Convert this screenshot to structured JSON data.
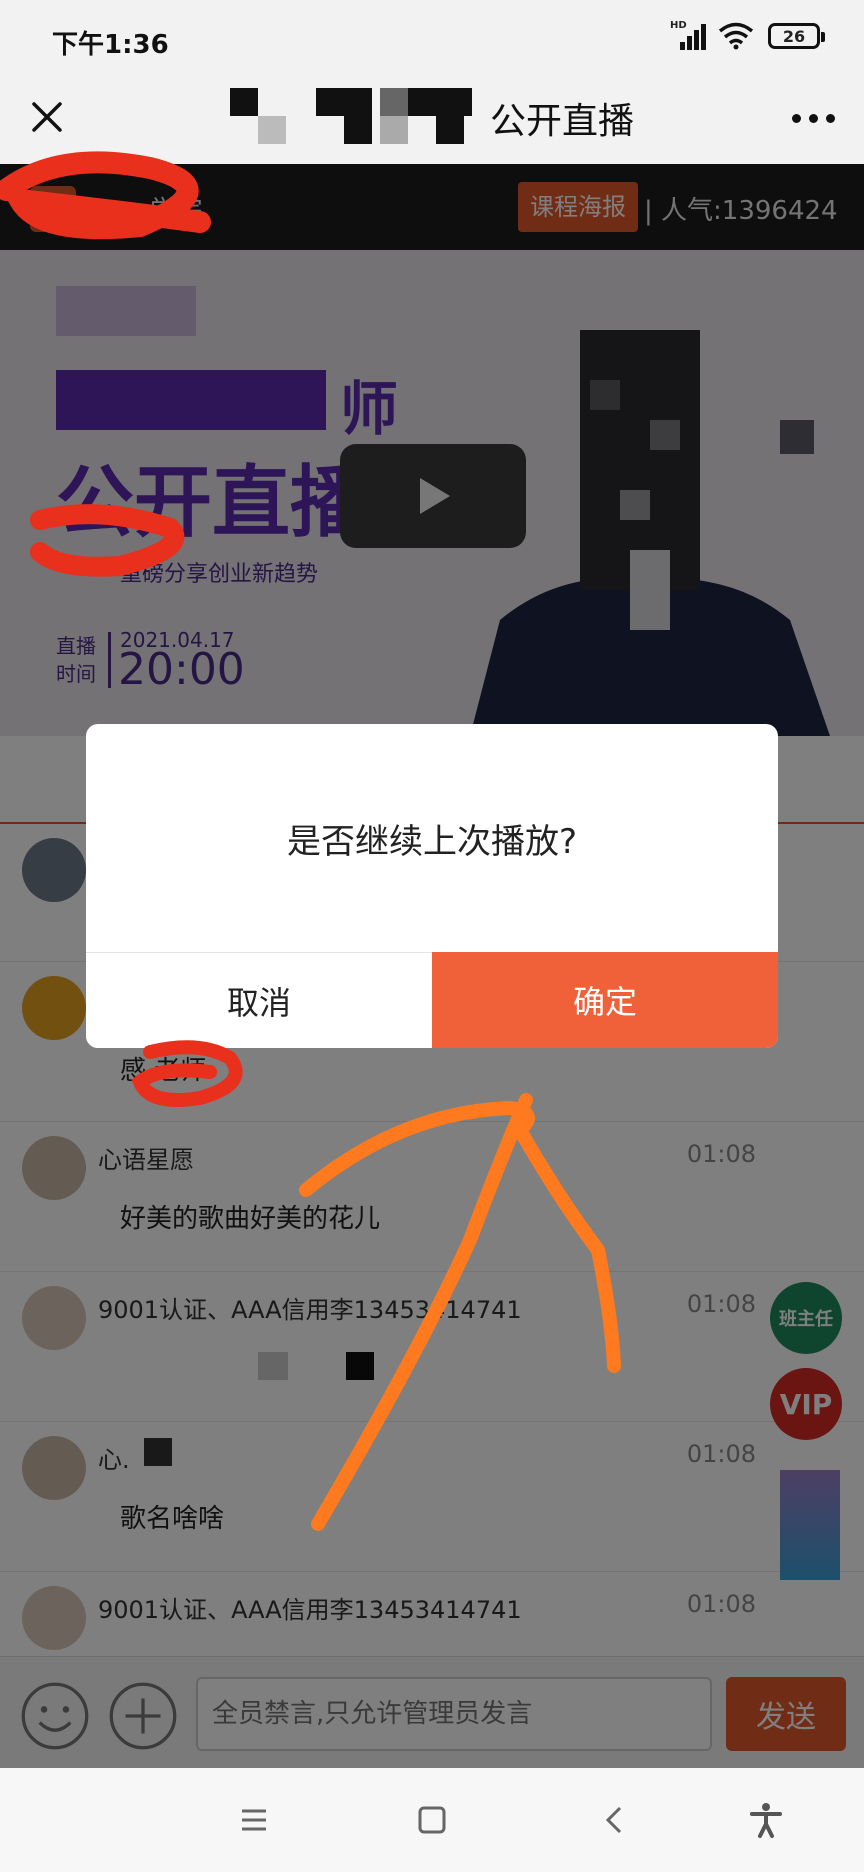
{
  "status_bar": {
    "time": "下午1:36",
    "signal_badge": "HD",
    "battery": "26"
  },
  "header": {
    "title": "公开直播"
  },
  "course": {
    "name": "学院",
    "poster_button": "课程海报",
    "popularity": "| 人气:1396424"
  },
  "video": {
    "headline_line1": "师",
    "headline_line2": "公开直播",
    "subtitle": "重磅分享创业新趋势",
    "date_label_1": "直播",
    "date_label_2": "时间",
    "date": "2021.04.17",
    "time": "20:00"
  },
  "messages": [
    {
      "name": "",
      "time": "",
      "text": ""
    },
    {
      "name": "",
      "time": "",
      "text": "感 老师"
    },
    {
      "name": "心语星愿",
      "time": "01:08",
      "text": "好美的歌曲好美的花儿"
    },
    {
      "name": "9001认证、AAA信用李13453414741",
      "time": "01:08",
      "text": ""
    },
    {
      "name": "心.",
      "time": "01:08",
      "text": "歌名啥啥"
    },
    {
      "name": "9001认证、AAA信用李13453414741",
      "time": "01:08",
      "text": ""
    }
  ],
  "side_buttons": {
    "head_teacher": "班主任",
    "vip": "VIP"
  },
  "input_bar": {
    "placeholder": "全员禁言,只允许管理员发言",
    "send": "发送"
  },
  "dialog": {
    "message": "是否继续上次播放?",
    "cancel": "取消",
    "confirm": "确定"
  },
  "colors": {
    "accent": "#f06039",
    "dark_header": "#1d1d1f",
    "annotation": "#ff7a1f",
    "redaction": "#e8301c"
  }
}
